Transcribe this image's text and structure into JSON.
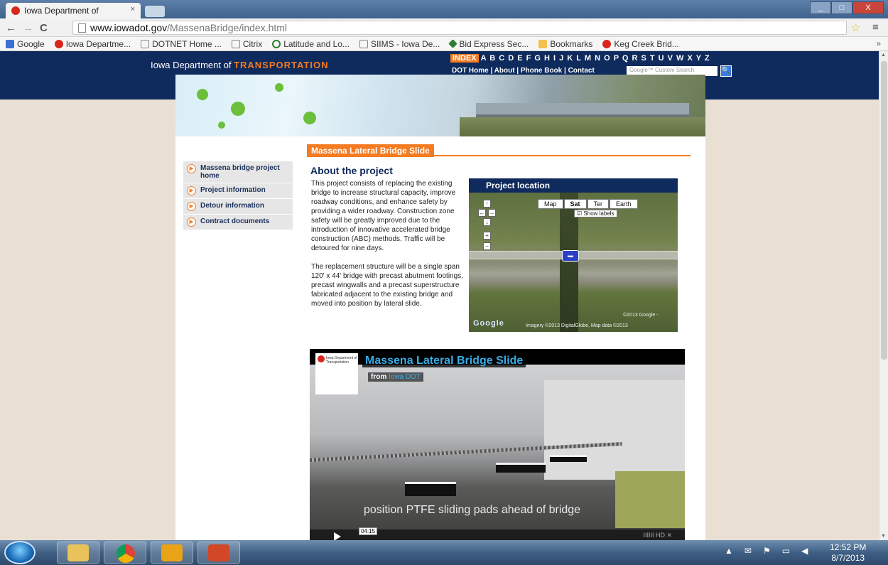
{
  "browser": {
    "tab_title": "Iowa Department of",
    "tab_close": "×",
    "url_host": "www.iowadot.gov",
    "url_path": "/MassenaBridge/index.html",
    "back": "←",
    "forward": "→",
    "reload": "C",
    "star": "☆",
    "menu": "≡",
    "window_buttons": {
      "minimize": "_",
      "maximize": "□",
      "close": "X"
    }
  },
  "bookmarks": {
    "items": [
      {
        "label": "Google",
        "color": "#3b6fd4"
      },
      {
        "label": "Iowa Departme...",
        "color": "#d9261c"
      },
      {
        "label": "DOTNET Home ...",
        "color": "#888888"
      },
      {
        "label": "Citrix",
        "color": "#888888"
      },
      {
        "label": "Latitude and Lo...",
        "color": "#2e7d32"
      },
      {
        "label": "SIIMS - Iowa De...",
        "color": "#888888"
      },
      {
        "label": "Bid Express Sec...",
        "color": "#2e7d32"
      },
      {
        "label": "Bookmarks",
        "color": "#f2c14e"
      },
      {
        "label": "Keg Creek Brid...",
        "color": "#d9261c"
      }
    ],
    "more": "»"
  },
  "site": {
    "title_prefix": "Iowa Department of",
    "title_accent": "TRANSPORTATION",
    "index_label": "INDEX",
    "index_letters": "A B C D E F G H I J K L M N O P Q R S T U V W X Y Z",
    "top_links": "DOT Home | About | Phone Book | Contact",
    "search_placeholder": "Google™ Custom Search",
    "search_button": "🔍"
  },
  "page": {
    "heading": "Massena Lateral Bridge Slide",
    "nav": [
      {
        "label": "Massena bridge project home"
      },
      {
        "label": "Project information"
      },
      {
        "label": "Detour information"
      },
      {
        "label": "Contract documents"
      }
    ],
    "about_title": "About the project",
    "about_p1": "This project consists of replacing the existing bridge to increase structural capacity, improve roadway conditions, and enhance safety by providing a wider roadway. Construction zone safety will be greatly improved due to the introduction of innovative accelerated bridge construction (ABC) methods. Traffic will be detoured for nine days.",
    "about_p2": "The replacement structure will be a single span 120' x 44' bridge with precast abutment footings, precast wingwalls and a precast superstructure fabricated adjacent to the existing bridge and moved into position by lateral slide."
  },
  "map": {
    "header": "Project location",
    "types": [
      "Map",
      "Sat",
      "Ter",
      "Earth"
    ],
    "active_type": "Sat",
    "show_labels": "Show labels",
    "controls": {
      "up": "↑",
      "left": "←",
      "right": "→",
      "down": "↓",
      "zoom_in": "+",
      "zoom_out": "−"
    },
    "copyright": "©2013 Google -",
    "imagery": "Imagery ©2013 DigitalGlobe, Map data ©2013",
    "google_logo": "Google"
  },
  "video": {
    "title": "Massena Lateral Bridge Slide",
    "from_label": "from",
    "from_source": "Iowa DOT",
    "logo_text": "Iowa Department of Transportation",
    "caption": "position PTFE sliding pads ahead of bridge",
    "time": "04:15",
    "hd": "IIIIII HD ✕"
  },
  "taskbar": {
    "time": "12:52 PM",
    "date": "8/7/2013"
  }
}
